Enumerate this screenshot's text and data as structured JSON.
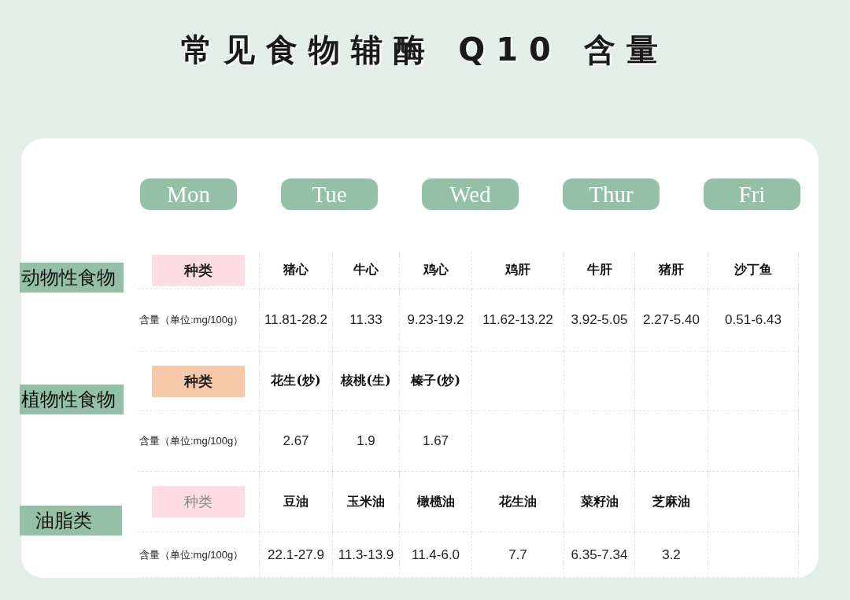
{
  "title": "常见食物辅酶 Q10 含量",
  "days": [
    "Mon",
    "Tue",
    "Wed",
    "Thur",
    "Fri"
  ],
  "sections": [
    {
      "name": "动物性食物",
      "type_label": "种类",
      "color": "#fddde3",
      "dimmed": false,
      "amount_label": "含量（单位:mg/100g）",
      "items": [
        {
          "name": "猪心",
          "amount": "11.81-28.2"
        },
        {
          "name": "牛心",
          "amount": "11.33"
        },
        {
          "name": "鸡心",
          "amount": "9.23-19.2"
        },
        {
          "name": "鸡肝",
          "amount": "11.62-13.22"
        },
        {
          "name": "牛肝",
          "amount": "3.92-5.05"
        },
        {
          "name": "猪肝",
          "amount": "2.27-5.40"
        },
        {
          "name": "沙丁鱼",
          "amount": "0.51-6.43"
        }
      ]
    },
    {
      "name": "植物性食物",
      "type_label": "种类",
      "color": "#f7c9a8",
      "dimmed": false,
      "amount_label": "含量（单位:mg/100g）",
      "items": [
        {
          "name": "花生(炒)",
          "amount": "2.67"
        },
        {
          "name": "核桃(生)",
          "amount": "1.9"
        },
        {
          "name": "榛子(炒)",
          "amount": "1.67"
        }
      ]
    },
    {
      "name": "油脂类",
      "type_label": "种类",
      "color": "#fddde3",
      "dimmed": true,
      "amount_label": "含量（单位:mg/100g）",
      "items": [
        {
          "name": "豆油",
          "amount": "22.1-27.9"
        },
        {
          "name": "玉米油",
          "amount": "11.3-13.9"
        },
        {
          "name": "橄榄油",
          "amount": "11.4-6.0"
        },
        {
          "name": "花生油",
          "amount": "7.7"
        },
        {
          "name": "菜籽油",
          "amount": "6.35-7.34"
        },
        {
          "name": "芝麻油",
          "amount": "3.2"
        }
      ]
    }
  ]
}
